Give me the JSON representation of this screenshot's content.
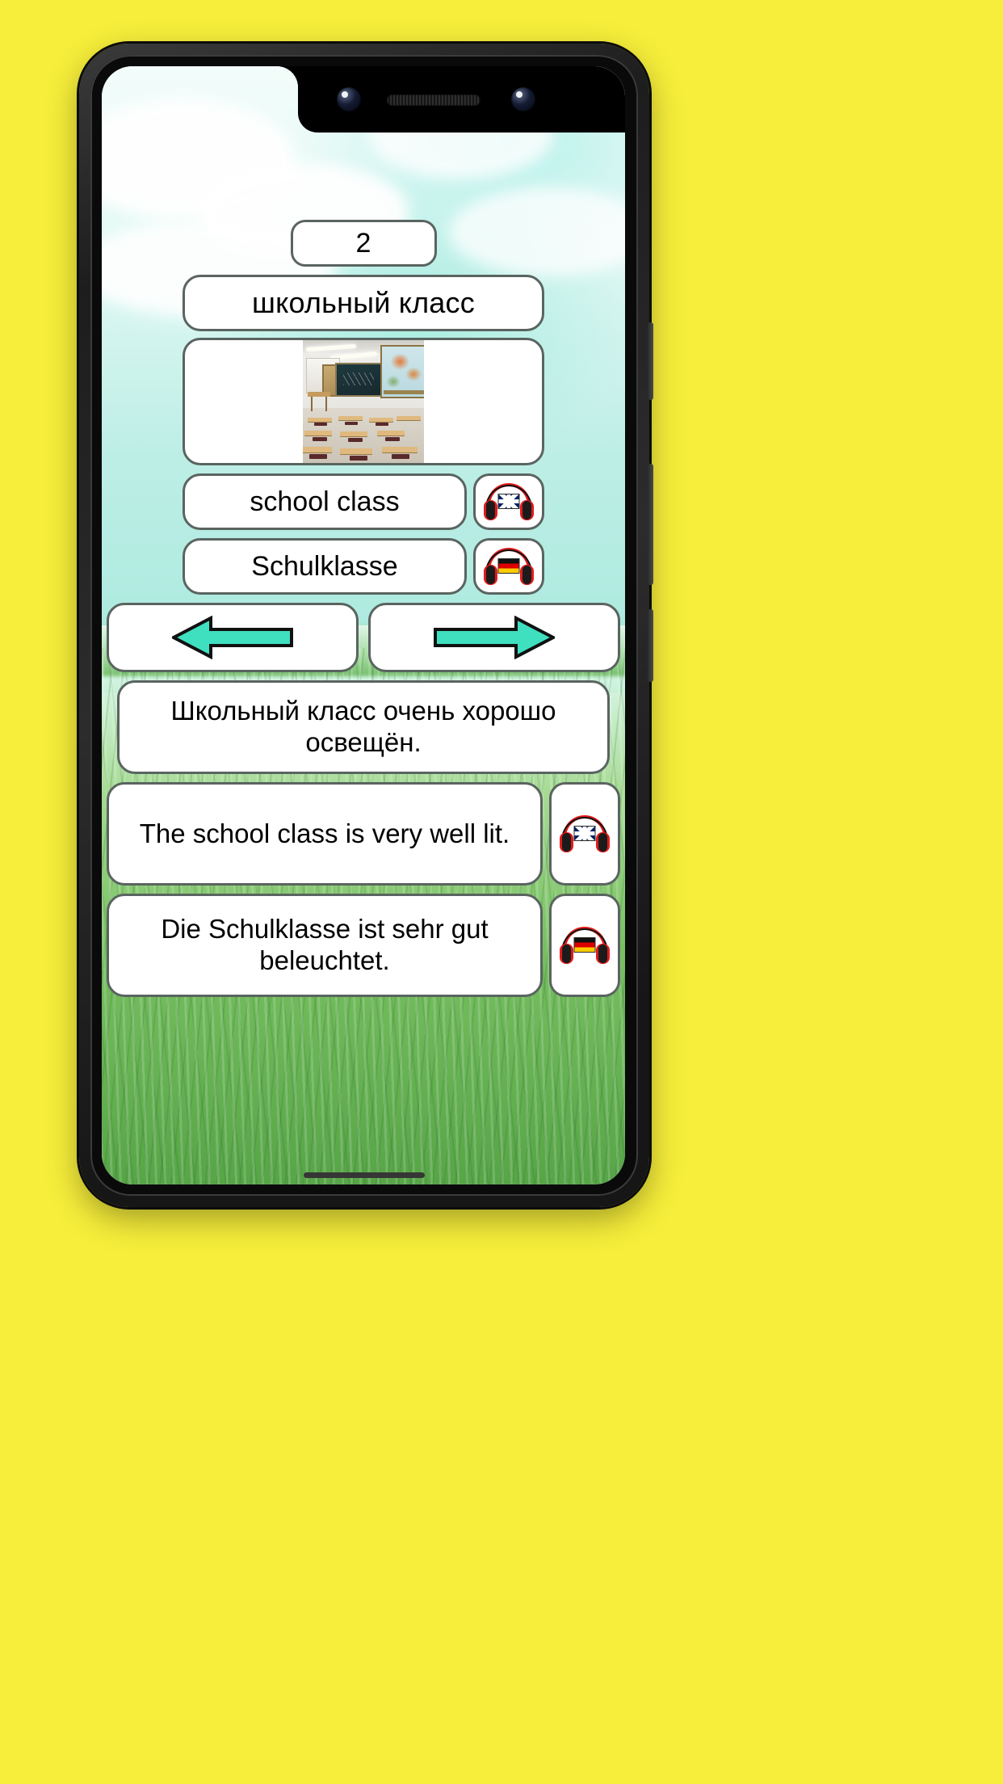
{
  "app": {
    "index_badge": "2",
    "word_ru": "школьный класс",
    "image_alt": "classroom-photo",
    "translations": [
      {
        "text": "school class",
        "audio_icon": "headphones-uk-flag-icon",
        "lang": "en"
      },
      {
        "text": "Schulklasse",
        "audio_icon": "headphones-de-flag-icon",
        "lang": "de"
      }
    ],
    "nav": {
      "prev_icon": "left-arrow-icon",
      "next_icon": "right-arrow-icon",
      "prev_label": "",
      "next_label": ""
    },
    "sentence_ru": "Школьный класс очень хорошо освещён.",
    "sentences": [
      {
        "text": "The school class is very well lit.",
        "audio_icon": "headphones-uk-flag-icon",
        "lang": "en"
      },
      {
        "text": "Die Schulklasse ist sehr gut beleuchtet.",
        "audio_icon": "headphones-de-flag-icon",
        "lang": "de"
      }
    ]
  },
  "colors": {
    "page_background": "#F6EE3A",
    "card_border": "#5a6460",
    "card_fill": "#ffffff",
    "arrow_fill": "#3FE0C0",
    "headphone_red": "#e11b1b",
    "sky": "#b6f0ea",
    "grass": "#6cba54"
  },
  "device": {
    "front_camera_icon": "camera-icon",
    "earpiece_icon": "speaker-grille-icon",
    "home_indicator_icon": "home-indicator-icon",
    "side_button_icon": "power-button-icon"
  }
}
